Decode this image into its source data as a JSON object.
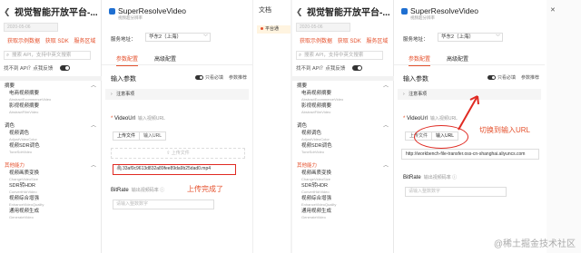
{
  "left": {
    "sidebar": {
      "title": "视觉智能开放平台-...",
      "date": "2020-05-06",
      "links": [
        "获取示例数据",
        "获取 SDK",
        "服务区域"
      ],
      "search_placeholder": "搜索 API，支持中英文搜索",
      "ask": "找不到 API？点我反馈",
      "categories": [
        {
          "label": "摘要",
          "orange": false
        },
        {
          "label": "调色",
          "orange": false
        },
        {
          "label": "其他能力",
          "orange": true
        }
      ],
      "items_a": [
        {
          "zh": "电商视频摘要",
          "en": "AbstractEcommerceVideo"
        },
        {
          "zh": "影视视频摘要",
          "en": "AbstractFilmVideo"
        }
      ],
      "items_b": [
        {
          "zh": "视频调色",
          "en": "AdjustVideoColor"
        },
        {
          "zh": "视频SDR调色",
          "en": "ToneSdrVideo"
        }
      ],
      "items_c": [
        {
          "zh": "视频画质变换",
          "en": "ChangeVideoSize"
        },
        {
          "zh": "SDR转HDR",
          "en": "ConvertHdrVideo"
        },
        {
          "zh": "视频综合增强",
          "en": "EnhanceVideoQuality"
        },
        {
          "zh": "通用视频生成",
          "en": "GenerateVideo"
        }
      ]
    },
    "main": {
      "api_title": "SuperResolveVideo",
      "api_sub": "视频超分辨率",
      "region_label": "服务地址：",
      "region_value": "华东2（上海）",
      "tabs": [
        "参数配置",
        "高级配置"
      ],
      "in_params": "输入参数",
      "only_required": "只看必填",
      "param_recommend": "参数推荐",
      "notice": "注意事项",
      "videourl_label": "VideoUrl",
      "videourl_hint": "输入视频URL",
      "seg": [
        "上传文件",
        "输入URL"
      ],
      "upload_text": "上传文件",
      "file_name": "33af0c9613d832a89fee89da9b25dad0.mp4",
      "bitrate_label": "BitRate",
      "bitrate_hint": "输出视频码率 ⓘ",
      "bitrate_placeholder": "请输入整数数字"
    },
    "annotation": "上传完成了",
    "strip": {
      "doc": "文档",
      "plat": "平台通"
    }
  },
  "right": {
    "sidebar": {
      "title": "视觉智能开放平台-...",
      "date": "2020-05-06",
      "links": [
        "获取示例数据",
        "获取 SDK",
        "服务区域"
      ],
      "search_placeholder": "搜索 API，支持中英文搜索",
      "ask": "找不到 API？点我反馈",
      "categories": [
        {
          "label": "摘要",
          "orange": false
        },
        {
          "label": "调色",
          "orange": false
        },
        {
          "label": "其他能力",
          "orange": true
        }
      ],
      "items_a": [
        {
          "zh": "电商视频摘要",
          "en": "AbstractEcommerceVideo"
        },
        {
          "zh": "影视视频摘要",
          "en": "AbstractFilmVideo"
        }
      ],
      "items_b": [
        {
          "zh": "视频调色",
          "en": "AdjustVideoColor"
        },
        {
          "zh": "视频SDR调色",
          "en": "ToneSdrVideo"
        }
      ],
      "items_c": [
        {
          "zh": "视频画质变换",
          "en": "ChangeVideoSize"
        },
        {
          "zh": "SDR转HDR",
          "en": "ConvertHdrVideo"
        },
        {
          "zh": "视频综合增强",
          "en": "EnhanceVideoQuality"
        },
        {
          "zh": "通用视频生成",
          "en": "GenerateVideo"
        }
      ]
    },
    "main": {
      "api_title": "SuperResolveVideo",
      "api_sub": "视频超分辨率",
      "region_label": "服务地址：",
      "region_value": "华东2（上海）",
      "tabs": [
        "参数配置",
        "高级配置"
      ],
      "in_params": "输入参数",
      "only_required": "只看必填",
      "param_recommend": "参数推荐",
      "notice": "注意事项",
      "videourl_label": "VideoUrl",
      "videourl_hint": "输入视频URL",
      "seg": [
        "上传文件",
        "输入URL"
      ],
      "url_value": "http://workbench-file-transfer.oss-cn-shanghai.aliyuncs.com",
      "bitrate_label": "BitRate",
      "bitrate_hint": "输出视频码率 ⓘ",
      "bitrate_placeholder": "请输入整数数字"
    },
    "annotation": "切换到输入URL"
  },
  "watermark": "@稀土掘金技术社区",
  "colors": {
    "accent": "#e5512d",
    "highlight": "#e02a22"
  }
}
